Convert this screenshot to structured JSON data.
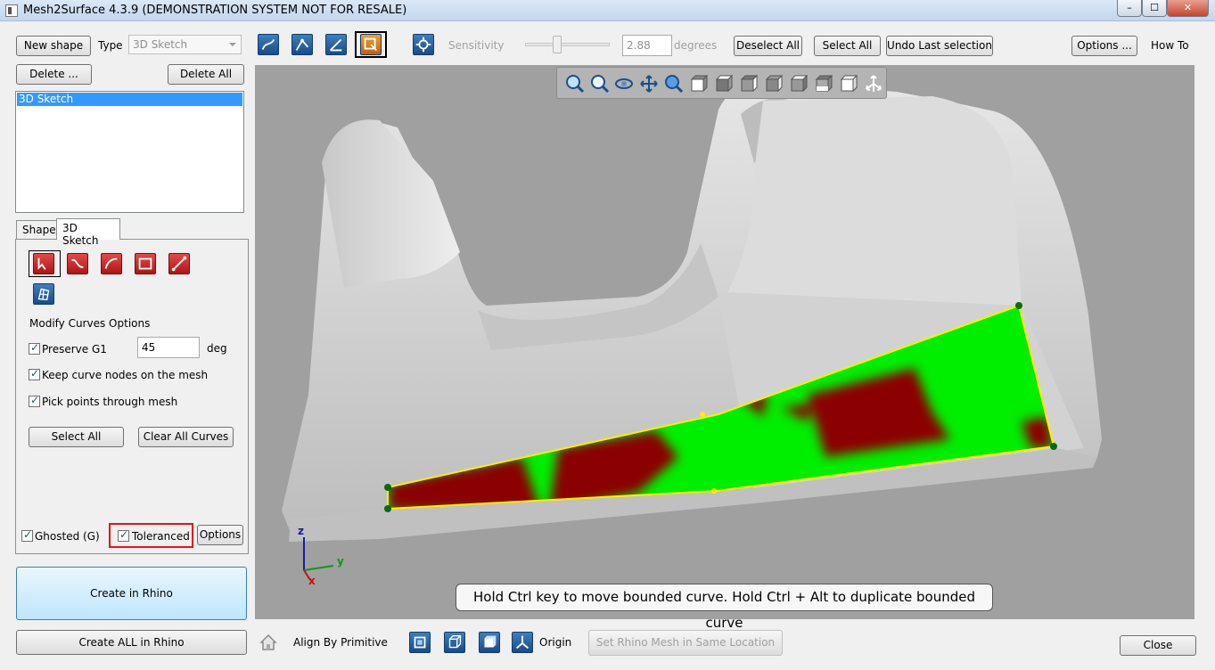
{
  "window": {
    "title": "Mesh2Surface 4.3.9 (DEMONSTRATION SYSTEM NOT FOR RESALE)",
    "minimize_glyph": "–",
    "maximize_glyph": "☐",
    "close_glyph": "✕"
  },
  "toolbar": {
    "new_shape_label": "New shape",
    "type_label": "Type",
    "type_value": "3D Sketch",
    "sensitivity_label": "Sensitivity",
    "sensitivity_value": "2.88",
    "degrees_label": "degrees",
    "deselect_all_label": "Deselect All",
    "select_all_label": "Select All",
    "undo_label": "Undo Last selection",
    "options_label": "Options ...",
    "how_to_label": "How To"
  },
  "left": {
    "delete_label": "Delete ...",
    "delete_all_label": "Delete All",
    "shapes": [
      "3D Sketch"
    ],
    "tabs": [
      "Shape",
      "3D Sketch"
    ],
    "active_tab": "3D Sketch",
    "modify_title": "Modify Curves Options",
    "preserve_g1_label": "Preserve G1",
    "preserve_g1_value": "45",
    "deg_label": "deg",
    "keep_nodes_label": "Keep curve nodes on the mesh",
    "pick_points_label": "Pick points through mesh",
    "select_all_label": "Select All",
    "clear_curves_label": "Clear All Curves",
    "ghosted_label": "Ghosted (G)",
    "toleranced_label": "Toleranced",
    "options_label": "Options",
    "create_label": "Create in Rhino",
    "create_all_label": "Create ALL in Rhino"
  },
  "viewport": {
    "hint": "Hold Ctrl key to move bounded curve. Hold Ctrl + Alt to duplicate bounded curve",
    "axis_z": "z",
    "axis_y": "y",
    "axis_x": "x"
  },
  "bottom": {
    "align_label": "Align By Primitive",
    "origin_label": "Origin",
    "set_mesh_label": "Set Rhino Mesh in Same Location",
    "close_label": "Close"
  },
  "colors": {
    "deviation_green": "#00ee00",
    "deviation_red": "#8b0000",
    "mesh_gray": "#d6d6d6",
    "highlight_red": "#e0141e"
  }
}
